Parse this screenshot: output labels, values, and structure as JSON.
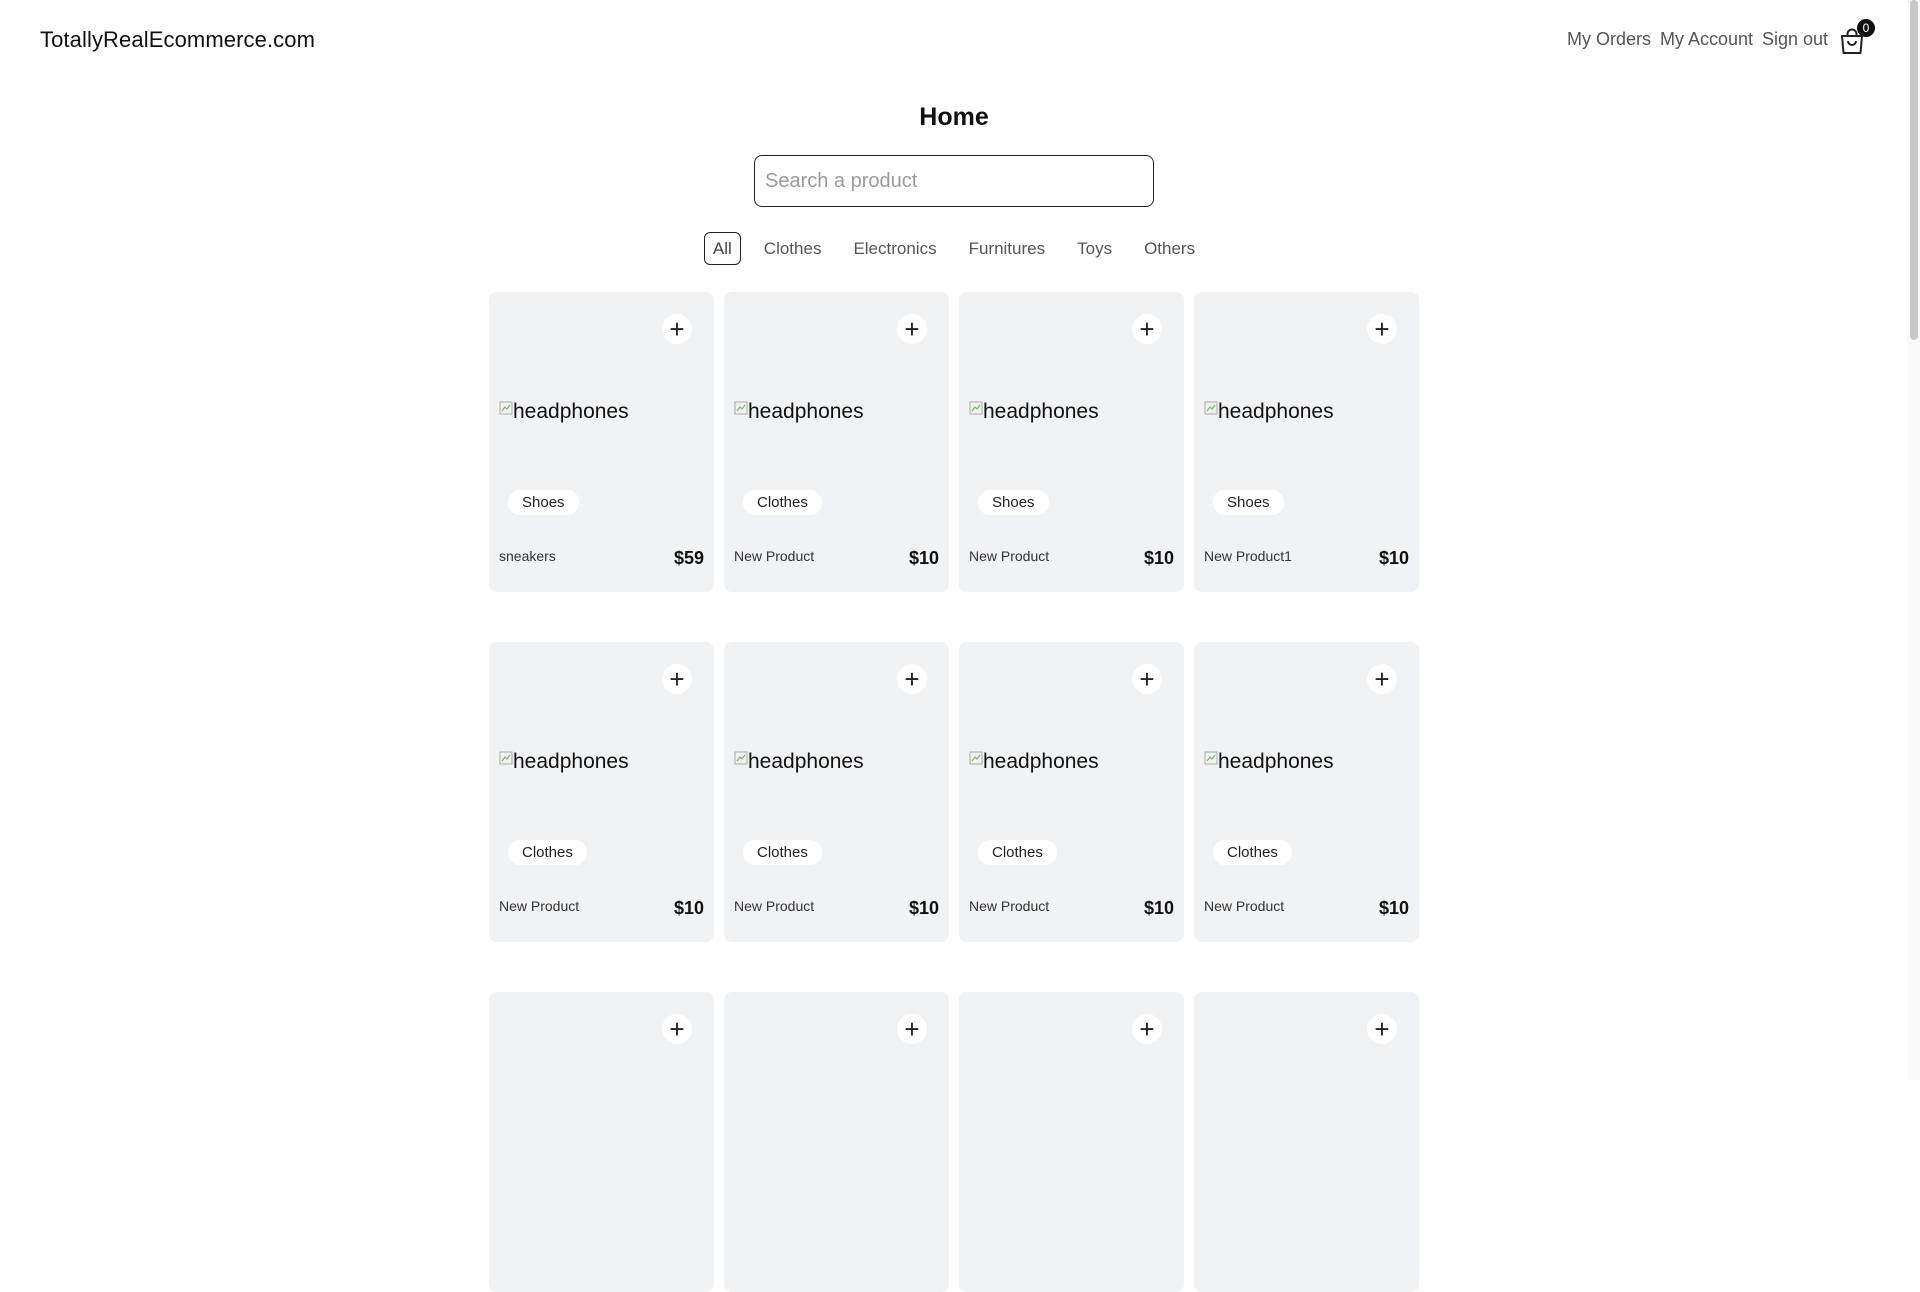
{
  "header": {
    "logo": "TotallyRealEcommerce.com",
    "nav": {
      "orders": "My Orders",
      "account": "My Account",
      "signout": "Sign out"
    },
    "cart_count": "0",
    "cart_icon": "shopping-bag-icon"
  },
  "main": {
    "title": "Home",
    "search": {
      "placeholder": "Search a product",
      "value": ""
    },
    "categories": [
      "All",
      "Clothes",
      "Electronics",
      "Furnitures",
      "Toys",
      "Others"
    ],
    "active_category": "All",
    "products": [
      {
        "image_alt": "headphones",
        "category": "Shoes",
        "name": "sneakers",
        "price": "$59"
      },
      {
        "image_alt": "headphones",
        "category": "Clothes",
        "name": "New Product",
        "price": "$10"
      },
      {
        "image_alt": "headphones",
        "category": "Shoes",
        "name": "New Product",
        "price": "$10"
      },
      {
        "image_alt": "headphones",
        "category": "Shoes",
        "name": "New Product1",
        "price": "$10"
      },
      {
        "image_alt": "headphones",
        "category": "Clothes",
        "name": "New Product",
        "price": "$10"
      },
      {
        "image_alt": "headphones",
        "category": "Clothes",
        "name": "New Product",
        "price": "$10"
      },
      {
        "image_alt": "headphones",
        "category": "Clothes",
        "name": "New Product",
        "price": "$10"
      },
      {
        "image_alt": "headphones",
        "category": "Clothes",
        "name": "New Product",
        "price": "$10"
      },
      {
        "image_alt": "",
        "category": "",
        "name": "",
        "price": ""
      },
      {
        "image_alt": "",
        "category": "",
        "name": "",
        "price": ""
      },
      {
        "image_alt": "",
        "category": "",
        "name": "",
        "price": ""
      },
      {
        "image_alt": "",
        "category": "",
        "name": "",
        "price": ""
      }
    ],
    "add_icon": "plus-icon",
    "add_label": "+"
  }
}
